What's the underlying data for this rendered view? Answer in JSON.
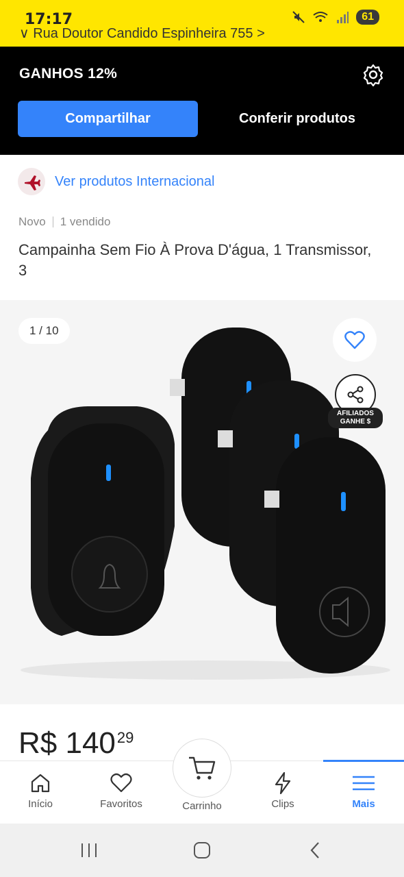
{
  "status_bar": {
    "time": "17:17",
    "address": "∨ Rua Doutor Candido Espinheira 755 >",
    "battery": "61"
  },
  "affiliate": {
    "gain_label": "GANHOS 12%",
    "share_button": "Compartilhar",
    "products_button": "Conferir produtos"
  },
  "international_link": "Ver produtos Internacional",
  "product": {
    "condition": "Novo",
    "sold": "1 vendido",
    "title": "Campainha Sem Fio À Prova D'água, 1 Transmissor, 3",
    "image_counter": "1 / 10",
    "affiliate_tag_line1": "AFILIADOS",
    "affiliate_tag_line2": "GANHE $",
    "price_main": "R$ 140",
    "price_cents": "29"
  },
  "bottom_nav": {
    "items": [
      {
        "label": "Início",
        "icon": "home-icon"
      },
      {
        "label": "Favoritos",
        "icon": "heart-icon"
      },
      {
        "label": "Carrinho",
        "icon": "cart-icon"
      },
      {
        "label": "Clips",
        "icon": "lightning-icon"
      },
      {
        "label": "Mais",
        "icon": "menu-icon"
      }
    ],
    "active": "Mais"
  },
  "colors": {
    "brand_yellow": "#ffe600",
    "accent_blue": "#3483fa",
    "banner_black": "#000000"
  }
}
